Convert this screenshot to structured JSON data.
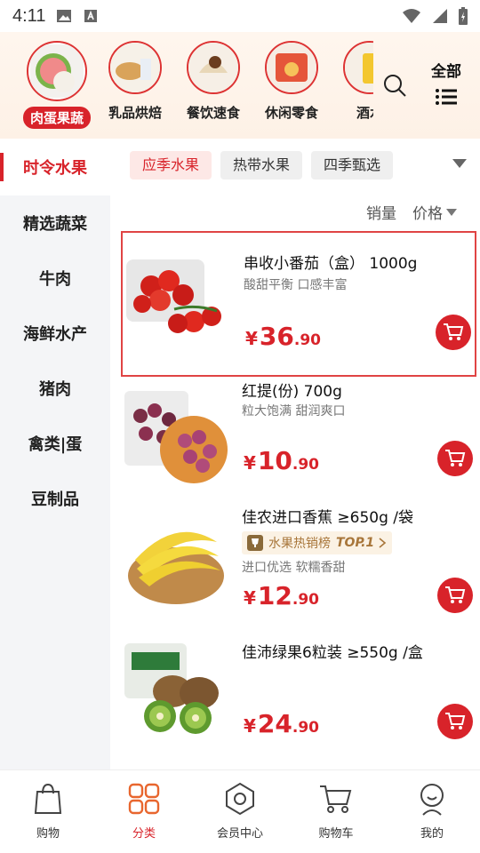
{
  "status_bar": {
    "time": "4:11"
  },
  "top_categories": {
    "items": [
      {
        "label": "肉蛋果蔬",
        "active": true
      },
      {
        "label": "乳品烘焙",
        "active": false
      },
      {
        "label": "餐饮速食",
        "active": false
      },
      {
        "label": "休闲零食",
        "active": false
      },
      {
        "label": "酒水",
        "active": false
      }
    ],
    "all_label": "全部"
  },
  "sidebar": {
    "items": [
      {
        "label": "时令水果",
        "active": true
      },
      {
        "label": "精选蔬菜",
        "active": false
      },
      {
        "label": "牛肉",
        "active": false
      },
      {
        "label": "海鲜水产",
        "active": false
      },
      {
        "label": "猪肉",
        "active": false
      },
      {
        "label": "禽类|蛋",
        "active": false
      },
      {
        "label": "豆制品",
        "active": false
      }
    ]
  },
  "subtabs": [
    {
      "label": "应季水果",
      "active": true
    },
    {
      "label": "热带水果",
      "active": false
    },
    {
      "label": "四季甄选",
      "active": false
    }
  ],
  "sort": {
    "sales": "销量",
    "price": "价格"
  },
  "products": [
    {
      "name": "串收小番茄（盒） 1000g",
      "desc": "酸甜平衡 口感丰富",
      "currency": "¥",
      "price_int": "36",
      "price_dec": ".90"
    },
    {
      "name": "红提(份) 700g",
      "desc": "粒大饱满 甜润爽口",
      "currency": "¥",
      "price_int": "10",
      "price_dec": ".90"
    },
    {
      "name": "佳农进口香蕉 ≥650g /袋",
      "rank_label": "水果热销榜",
      "rank_top": "TOP.1",
      "desc": "进口优选 软糯香甜",
      "currency": "¥",
      "price_int": "12",
      "price_dec": ".90"
    },
    {
      "name": "佳沛绿果6粒装 ≥550g /盒",
      "desc": "",
      "currency": "¥",
      "price_int": "24",
      "price_dec": ".90"
    }
  ],
  "bottom_nav": [
    {
      "label": "购物",
      "icon": "shopping-bag-icon",
      "active": false
    },
    {
      "label": "分类",
      "icon": "category-grid-icon",
      "active": true
    },
    {
      "label": "会员中心",
      "icon": "member-hexagon-icon",
      "active": false
    },
    {
      "label": "购物车",
      "icon": "cart-icon",
      "active": false
    },
    {
      "label": "我的",
      "icon": "profile-icon",
      "active": false
    }
  ],
  "colors": {
    "accent": "#d8232a",
    "highlight_border": "#e04444"
  }
}
